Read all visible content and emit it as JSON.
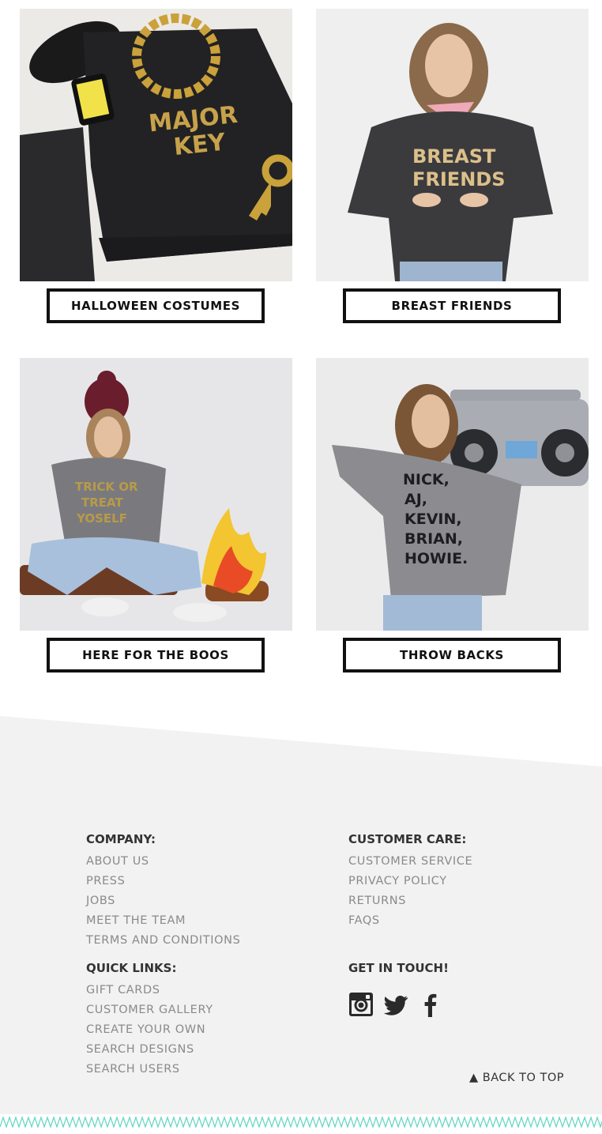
{
  "tiles": [
    {
      "button_label": "HALLOWEEN COSTUMES",
      "shirt_text": [
        "MAJOR",
        "KEY"
      ]
    },
    {
      "button_label": "BREAST FRIENDS",
      "shirt_text": [
        "BREAST",
        "FRIENDS"
      ]
    },
    {
      "button_label": "HERE FOR THE BOOS",
      "shirt_text": [
        "TRICK OR",
        "TREAT",
        "YOSELF"
      ]
    },
    {
      "button_label": "THROW BACKS",
      "shirt_text": [
        "NICK,",
        "AJ,",
        "KEVIN,",
        "BRIAN,",
        "HOWIE."
      ]
    }
  ],
  "footer": {
    "company": {
      "heading": "COMPANY:",
      "links": [
        "ABOUT US",
        "PRESS",
        "JOBS",
        "MEET THE TEAM",
        "TERMS AND CONDITIONS"
      ]
    },
    "customer_care": {
      "heading": "CUSTOMER CARE:",
      "links": [
        "CUSTOMER SERVICE",
        "PRIVACY POLICY",
        "RETURNS",
        "FAQS"
      ]
    },
    "quick_links": {
      "heading": "QUICK LINKS:",
      "links": [
        "GIFT CARDS",
        "CUSTOMER GALLERY",
        "CREATE YOUR OWN",
        "SEARCH DESIGNS",
        "SEARCH USERS"
      ]
    },
    "get_in_touch": {
      "heading": "GET IN TOUCH!",
      "icons": [
        "instagram-icon",
        "twitter-icon",
        "facebook-icon"
      ]
    },
    "back_to_top": "▲ BACK TO TOP"
  },
  "colors": {
    "footer_bg": "#f2f2f2",
    "zigzag": "#5fd6bf",
    "button_border": "#111111",
    "link_text": "#8a8a8a",
    "heading_text": "#333333"
  }
}
